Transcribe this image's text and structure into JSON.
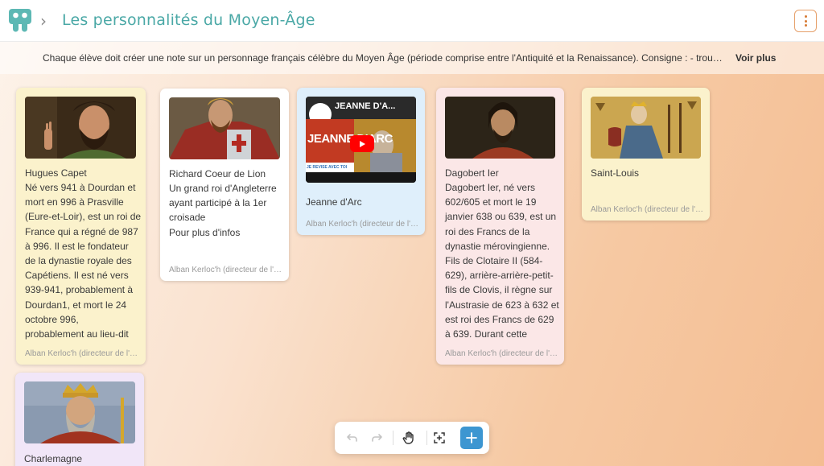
{
  "header": {
    "board_title": "Les personnalités du Moyen-Âge",
    "chevron": "›"
  },
  "description": {
    "text": "Chaque élève doit créer une note sur un personnage français célèbre du Moyen Âge (période comprise entre l'Antiquité et la Renaissance). Consigne : - trouver une personnalité",
    "more_label": "Voir plus"
  },
  "cards": [
    {
      "title": "Hugues Capet",
      "body": "Né vers 941 à Dourdan et\nmort en 996 à Prasville\n(Eure-et-Loir), est un roi de\nFrance qui a régné de 987\nà 996. Il est le fondateur\nde la dynastie royale des\nCapétiens. Il est né vers\n939-941, probablement à\nDourdan1, et mort le 24\noctobre 996,\nprobablement au lieu-dit",
      "author": "Alban Kerloc'h (directeur de l'école)",
      "color": "#fbf2cc"
    },
    {
      "title": "Richard Coeur de Lion",
      "body": "Un grand roi d'Angleterre\nayant participé à la 1er\ncroisade\nPour plus d'infos",
      "author": "Alban Kerloc'h (directeur de l'école)",
      "color": "#ffffff"
    },
    {
      "title": "Jeanne d'Arc",
      "video_title": "JEANNE D'A...",
      "video_overlay": "JEANNE D'ARC",
      "video_badge": "JE REVISE AVEC TOI",
      "author": "Alban Kerloc'h (directeur de l'école)",
      "color": "#dfeffb"
    },
    {
      "title": "Dagobert Ier",
      "body": "Dagobert Ier, né vers\n602/605 et mort le 19\njanvier 638 ou 639, est un\nroi des Francs de la\ndynastie mérovingienne.\nFils de Clotaire II (584-\n629), arrière-arrière-petit-\nfils de Clovis, il règne sur\nl'Austrasie de 623 à 632 et\nest roi des Francs de 629\nà 639. Durant cette",
      "author": "Alban Kerloc'h (directeur de l'école)",
      "color": "#fbe7e7"
    },
    {
      "title": "Saint-Louis",
      "author": "Alban Kerloc'h (directeur de l'école)",
      "color": "#fbf2cc"
    },
    {
      "title": "Charlemagne",
      "color": "#f1e6f8"
    }
  ],
  "toolbar": {
    "undo_icon": "undo-icon",
    "redo_icon": "redo-icon",
    "hand_icon": "hand-icon",
    "focus_icon": "focus-icon",
    "add_icon": "plus-icon"
  },
  "colors": {
    "accent_teal": "#4aa8a6",
    "add_button": "#3d96d1",
    "menu_border": "#e6a06a"
  }
}
